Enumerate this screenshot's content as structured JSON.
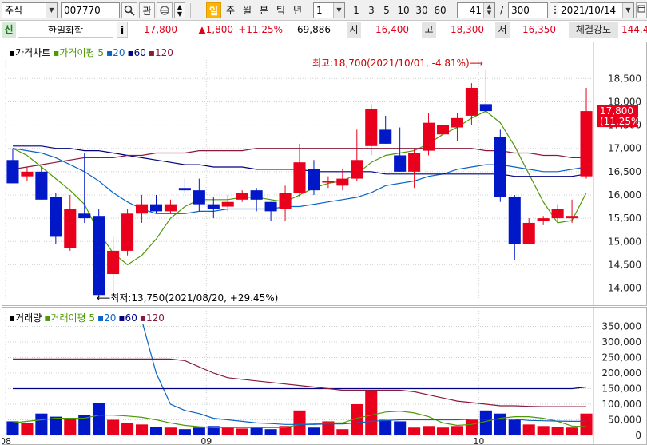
{
  "toolbar": {
    "market": "주식",
    "code": "007770",
    "search_icon": "search-icon",
    "gwan": "관",
    "interval_tabs": [
      "일",
      "주",
      "월",
      "분",
      "틱",
      "년"
    ],
    "interval_selected": 0,
    "multiplier": "1",
    "period_buttons": [
      "1",
      "3",
      "5",
      "10",
      "30",
      "60"
    ],
    "count_value": "41",
    "count_sep": "/",
    "count_total": "300",
    "date": "2021/10/14"
  },
  "info": {
    "badge": "신",
    "name": "한일화학",
    "info_icon": "i",
    "price": "17,800",
    "change": "▲1,800",
    "change_pct": "+11.25%",
    "volume": "69,886",
    "open_label": "시",
    "open": "16,400",
    "high_label": "고",
    "high": "18,300",
    "low_label": "저",
    "low": "16,350",
    "strength_label": "체결강도",
    "strength": "144.4"
  },
  "price_chart": {
    "legend": [
      {
        "text": "가격차트",
        "color": "#000000"
      },
      {
        "text": "가격이평 5",
        "color": "#4e9a06"
      },
      {
        "text": "20",
        "color": "#0a64c8"
      },
      {
        "text": "60",
        "color": "#000080"
      },
      {
        "text": "120",
        "color": "#8b1a3a"
      }
    ],
    "high_note": "최고:18,700(2021/10/01, -4.81%)⟶",
    "low_note": "⟵최저:13,750(2021/08/20, +29.45%)",
    "last_price_label": "17,800",
    "last_pct_label": "(11.25%)"
  },
  "volume_chart": {
    "legend": [
      {
        "text": "거래량",
        "color": "#000000"
      },
      {
        "text": "거래이평 5",
        "color": "#4e9a06"
      },
      {
        "text": "20",
        "color": "#0a64c8"
      },
      {
        "text": "60",
        "color": "#000080"
      },
      {
        "text": "120",
        "color": "#8b1a3a"
      }
    ]
  },
  "chart_data": [
    {
      "type": "candlestick",
      "title": "가격차트",
      "ylim": [
        13700,
        18900
      ],
      "yticks": [
        14000,
        14500,
        15000,
        15500,
        16000,
        16500,
        17000,
        17500,
        18000,
        18500
      ],
      "ytick_labels": [
        "14,000",
        "14,500",
        "15,000",
        "15,500",
        "16,000",
        "16,500",
        "17,000",
        "17,500",
        "18,000",
        "18,500"
      ],
      "x_month_labels": [
        {
          "index": 0,
          "text": "08"
        },
        {
          "index": 14,
          "text": "09"
        },
        {
          "index": 33,
          "text": "10"
        }
      ],
      "candles": [
        {
          "o": 16750,
          "h": 17000,
          "l": 16250,
          "c": 16250
        },
        {
          "o": 16400,
          "h": 16600,
          "l": 16300,
          "c": 16500
        },
        {
          "o": 16500,
          "h": 16600,
          "l": 15900,
          "c": 15900
        },
        {
          "o": 15950,
          "h": 16050,
          "l": 14950,
          "c": 15100
        },
        {
          "o": 14850,
          "h": 16000,
          "l": 14800,
          "c": 15700
        },
        {
          "o": 15600,
          "h": 16900,
          "l": 15400,
          "c": 15500
        },
        {
          "o": 15550,
          "h": 15700,
          "l": 13800,
          "c": 13850
        },
        {
          "o": 14300,
          "h": 15100,
          "l": 13900,
          "c": 14800
        },
        {
          "o": 14800,
          "h": 15700,
          "l": 14700,
          "c": 15600
        },
        {
          "o": 15600,
          "h": 16000,
          "l": 15400,
          "c": 15800
        },
        {
          "o": 15800,
          "h": 16000,
          "l": 15600,
          "c": 15650
        },
        {
          "o": 15650,
          "h": 15900,
          "l": 15600,
          "c": 15800
        },
        {
          "o": 16150,
          "h": 16350,
          "l": 16050,
          "c": 16100
        },
        {
          "o": 16100,
          "h": 16350,
          "l": 15650,
          "c": 15800
        },
        {
          "o": 15800,
          "h": 15950,
          "l": 15500,
          "c": 15700
        },
        {
          "o": 15750,
          "h": 16000,
          "l": 15650,
          "c": 15850
        },
        {
          "o": 15900,
          "h": 16100,
          "l": 15850,
          "c": 16050
        },
        {
          "o": 16100,
          "h": 16150,
          "l": 15650,
          "c": 15900
        },
        {
          "o": 15850,
          "h": 15850,
          "l": 15450,
          "c": 15650
        },
        {
          "o": 15700,
          "h": 16200,
          "l": 15450,
          "c": 16050
        },
        {
          "o": 16050,
          "h": 17100,
          "l": 15950,
          "c": 16700
        },
        {
          "o": 16550,
          "h": 16750,
          "l": 16000,
          "c": 16100
        },
        {
          "o": 16300,
          "h": 16400,
          "l": 16150,
          "c": 16300
        },
        {
          "o": 16200,
          "h": 16550,
          "l": 16100,
          "c": 16350
        },
        {
          "o": 16350,
          "h": 17400,
          "l": 16300,
          "c": 16750
        },
        {
          "o": 17050,
          "h": 17950,
          "l": 16850,
          "c": 17850
        },
        {
          "o": 17400,
          "h": 17700,
          "l": 17100,
          "c": 17100
        },
        {
          "o": 16850,
          "h": 17450,
          "l": 16500,
          "c": 16500
        },
        {
          "o": 16500,
          "h": 17000,
          "l": 16150,
          "c": 16900
        },
        {
          "o": 16950,
          "h": 17750,
          "l": 16850,
          "c": 17550
        },
        {
          "o": 17300,
          "h": 17650,
          "l": 17150,
          "c": 17500
        },
        {
          "o": 17450,
          "h": 17750,
          "l": 17150,
          "c": 17650
        },
        {
          "o": 17700,
          "h": 18400,
          "l": 17500,
          "c": 18300
        },
        {
          "o": 17950,
          "h": 18700,
          "l": 17750,
          "c": 17800
        },
        {
          "o": 17250,
          "h": 17400,
          "l": 15850,
          "c": 15950
        },
        {
          "o": 15950,
          "h": 16000,
          "l": 14600,
          "c": 14950
        },
        {
          "o": 14950,
          "h": 15500,
          "l": 14950,
          "c": 15400
        },
        {
          "o": 15450,
          "h": 15550,
          "l": 15350,
          "c": 15500
        },
        {
          "o": 15500,
          "h": 15800,
          "l": 15450,
          "c": 15700
        },
        {
          "o": 15500,
          "h": 15900,
          "l": 15400,
          "c": 15550
        },
        {
          "o": 16400,
          "h": 18300,
          "l": 16350,
          "c": 17800
        }
      ],
      "series": [
        {
          "name": "가격이평 5",
          "color": "#4e9a06",
          "values": [
            17000,
            16850,
            16600,
            16350,
            16100,
            15800,
            15200,
            14750,
            14500,
            14700,
            15050,
            15500,
            15750,
            15900,
            15900,
            15900,
            15950,
            15950,
            15900,
            15850,
            16000,
            16150,
            16250,
            16300,
            16450,
            16700,
            16850,
            16900,
            16950,
            17100,
            17300,
            17450,
            17650,
            17800,
            17550,
            17050,
            16450,
            15850,
            15400,
            15450,
            16050
          ]
        },
        {
          "name": "20",
          "color": "#0a64c8",
          "values": [
            17000,
            16950,
            16900,
            16800,
            16650,
            16500,
            16300,
            16050,
            15850,
            15700,
            15600,
            15600,
            15600,
            15650,
            15650,
            15700,
            15700,
            15700,
            15700,
            15750,
            15750,
            15800,
            15850,
            15900,
            15950,
            16050,
            16200,
            16250,
            16300,
            16400,
            16450,
            16550,
            16600,
            16650,
            16650,
            16600,
            16550,
            16500,
            16500,
            16550,
            16600
          ]
        },
        {
          "name": "60",
          "color": "#000080",
          "values": [
            17050,
            17050,
            17050,
            17000,
            17000,
            16950,
            16950,
            16900,
            16850,
            16800,
            16750,
            16700,
            16650,
            16650,
            16600,
            16600,
            16600,
            16550,
            16550,
            16550,
            16550,
            16500,
            16500,
            16500,
            16500,
            16500,
            16450,
            16450,
            16450,
            16450,
            16450,
            16450,
            16450,
            16450,
            16450,
            16400,
            16400,
            16400,
            16400,
            16400,
            16450
          ]
        },
        {
          "name": "120",
          "color": "#8b1a3a",
          "values": [
            16550,
            16600,
            16650,
            16700,
            16750,
            16800,
            16800,
            16800,
            16850,
            16850,
            16900,
            16900,
            16900,
            16950,
            16950,
            16950,
            16950,
            17000,
            17000,
            17000,
            17000,
            17000,
            17000,
            17000,
            17000,
            17000,
            17000,
            17000,
            17000,
            17000,
            17000,
            17000,
            17000,
            16950,
            16950,
            16900,
            16900,
            16850,
            16850,
            16800,
            16800
          ]
        }
      ]
    },
    {
      "type": "bar",
      "title": "거래량",
      "ylim": [
        0,
        400000
      ],
      "yticks": [
        0,
        50000,
        100000,
        150000,
        200000,
        250000,
        300000,
        350000
      ],
      "ytick_labels": [
        "0",
        "50,000",
        "100,000",
        "150,000",
        "200,000",
        "250,000",
        "300,000",
        "350,000"
      ],
      "values": [
        45000,
        40000,
        70000,
        60000,
        55000,
        65000,
        105000,
        50000,
        40000,
        35000,
        28000,
        25000,
        20000,
        25000,
        30000,
        25000,
        22000,
        25000,
        20000,
        30000,
        80000,
        25000,
        45000,
        20000,
        100000,
        145000,
        50000,
        45000,
        25000,
        30000,
        25000,
        30000,
        50000,
        80000,
        70000,
        50000,
        35000,
        30000,
        28000,
        25000,
        70000
      ],
      "series": [
        {
          "name": "거래이평 5",
          "color": "#4e9a06",
          "values": [
            40000,
            45000,
            50000,
            55000,
            55000,
            55000,
            65000,
            65000,
            62000,
            58000,
            50000,
            40000,
            32000,
            28000,
            25000,
            25000,
            25000,
            25000,
            25000,
            25000,
            35000,
            37000,
            40000,
            40000,
            55000,
            65000,
            75000,
            78000,
            72000,
            60000,
            40000,
            32000,
            35000,
            45000,
            55000,
            60000,
            60000,
            55000,
            45000,
            30000,
            28000
          ]
        },
        {
          "name": "20",
          "color": "#0a64c8",
          "values": [
            380000,
            380000,
            380000,
            380000,
            380000,
            380000,
            380000,
            380000,
            380000,
            370000,
            200000,
            100000,
            80000,
            70000,
            55000,
            50000,
            45000,
            40000,
            38000,
            35000,
            35000,
            35000,
            37000,
            37000,
            40000,
            45000,
            48000,
            50000,
            50000,
            50000,
            50000,
            50000,
            52000,
            52000,
            52000,
            52000,
            48000,
            47000,
            46000,
            45000,
            45000
          ]
        },
        {
          "name": "60",
          "color": "#000080",
          "values": [
            150000,
            150000,
            150000,
            150000,
            150000,
            150000,
            150000,
            150000,
            150000,
            150000,
            150000,
            150000,
            150000,
            150000,
            150000,
            150000,
            150000,
            150000,
            150000,
            150000,
            150000,
            150000,
            150000,
            150000,
            150000,
            150000,
            150000,
            150000,
            150000,
            150000,
            150000,
            150000,
            150000,
            150000,
            150000,
            150000,
            150000,
            150000,
            150000,
            150000,
            155000
          ]
        },
        {
          "name": "120",
          "color": "#8b1a3a",
          "values": [
            245000,
            245000,
            245000,
            245000,
            245000,
            245000,
            245000,
            245000,
            245000,
            245000,
            245000,
            245000,
            240000,
            220000,
            200000,
            185000,
            180000,
            175000,
            170000,
            165000,
            160000,
            155000,
            150000,
            145000,
            145000,
            145000,
            145000,
            145000,
            140000,
            130000,
            120000,
            110000,
            105000,
            100000,
            95000,
            95000,
            93000,
            92000,
            92000,
            92000,
            92000
          ]
        }
      ]
    }
  ]
}
